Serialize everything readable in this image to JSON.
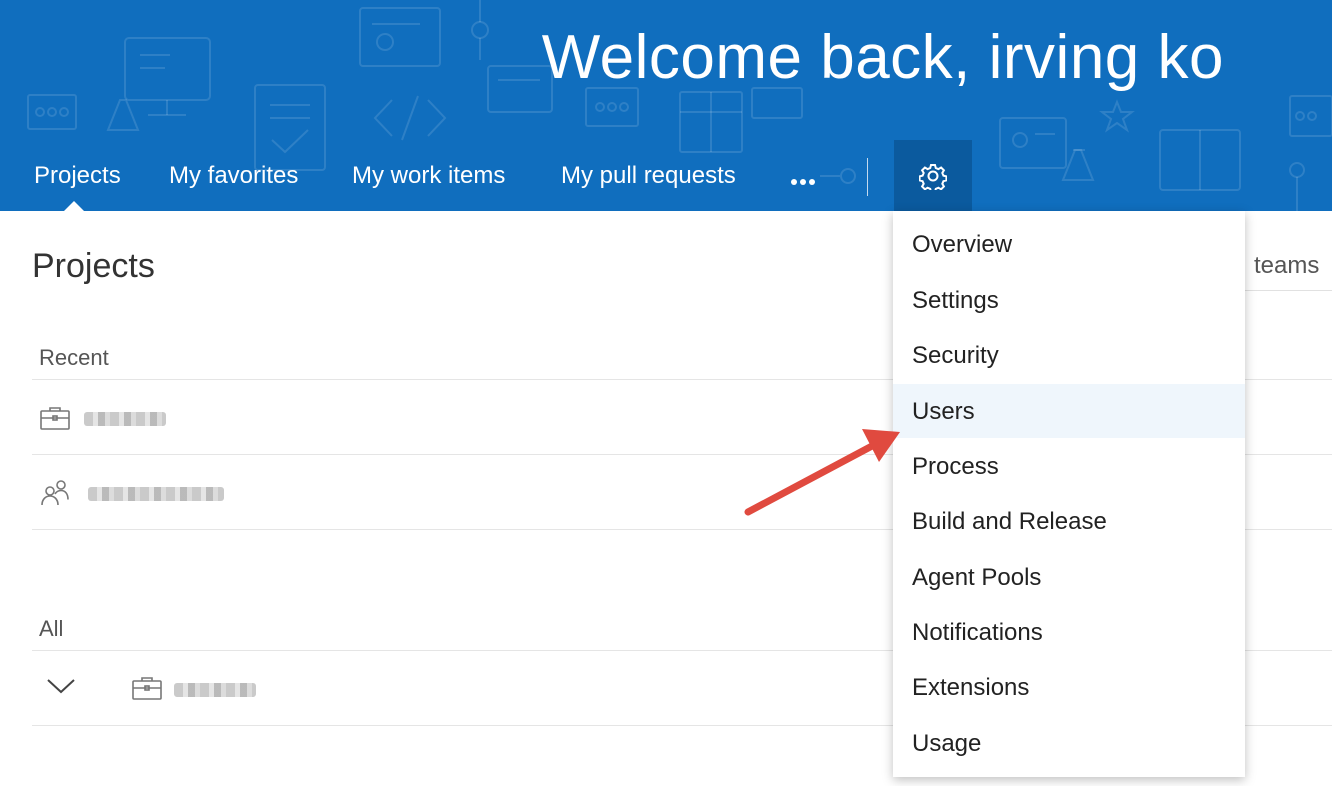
{
  "header": {
    "welcome": "Welcome back, irving ko",
    "tabs": [
      {
        "label": "Projects",
        "active": true
      },
      {
        "label": "My favorites"
      },
      {
        "label": "My work items"
      },
      {
        "label": "My pull requests"
      }
    ],
    "more_icon": "ellipsis-icon",
    "settings_icon": "gear-icon",
    "accent": "#106ebe"
  },
  "main": {
    "title": "Projects",
    "teams_label": "teams",
    "recent_label": "Recent",
    "all_label": "All",
    "recent_items": [
      {
        "icon": "briefcase-icon",
        "name_redacted": true
      },
      {
        "icon": "people-icon",
        "name_redacted": true
      }
    ],
    "all_items": [
      {
        "icon": "briefcase-icon",
        "expander": "chevron-down-icon",
        "name_redacted": true
      }
    ]
  },
  "settings_menu": {
    "items": [
      {
        "label": "Overview"
      },
      {
        "label": "Settings"
      },
      {
        "label": "Security"
      },
      {
        "label": "Users",
        "highlighted": true
      },
      {
        "label": "Process"
      },
      {
        "label": "Build and Release"
      },
      {
        "label": "Agent Pools"
      },
      {
        "label": "Notifications"
      },
      {
        "label": "Extensions"
      },
      {
        "label": "Usage"
      }
    ],
    "hover_color": "#eff6fc"
  },
  "annotation": {
    "arrow_color": "#e04a3f",
    "points_to": "Users"
  }
}
